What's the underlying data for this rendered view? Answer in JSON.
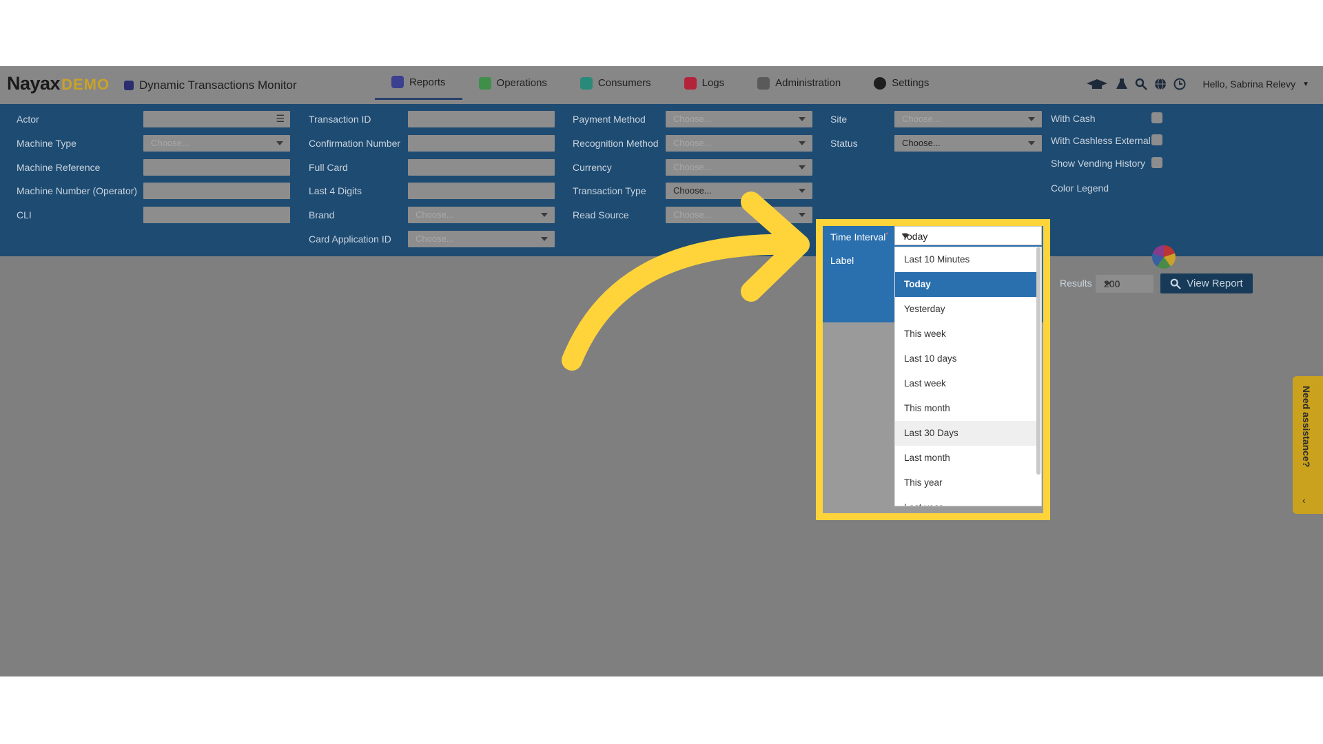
{
  "header": {
    "logo_main": "Nayax",
    "logo_badge": "DEMO",
    "page_title": "Dynamic Transactions Monitor",
    "nav": [
      {
        "label": "Reports",
        "icon": "chart-icon",
        "color": "#3a3f8f"
      },
      {
        "label": "Operations",
        "icon": "operations-icon",
        "color": "#3f8f4a"
      },
      {
        "label": "Consumers",
        "icon": "consumers-icon",
        "color": "#2a8a7a"
      },
      {
        "label": "Logs",
        "icon": "logs-icon",
        "color": "#b3243a"
      },
      {
        "label": "Administration",
        "icon": "administration-icon",
        "color": "#5a5a5a"
      },
      {
        "label": "Settings",
        "icon": "gear-icon",
        "color": "#1e1e1e"
      }
    ],
    "greeting": "Hello, Sabrina Relevy"
  },
  "filters": {
    "col1": [
      "Actor",
      "Machine Type",
      "Machine Reference",
      "Machine Number (Operator)",
      "CLI"
    ],
    "col2": [
      "Transaction ID",
      "Confirmation Number",
      "Full Card",
      "Last 4 Digits",
      "Brand",
      "Card Application ID"
    ],
    "col3": [
      "Payment Method",
      "Recognition Method",
      "Currency",
      "Transaction Type",
      "Read Source"
    ],
    "col4": [
      "Site",
      "Status"
    ],
    "col5": [
      "With Cash",
      "With Cashless External",
      "Show Vending History",
      "Color Legend"
    ],
    "choose_placeholder": "Choose...",
    "status_value": "Choose...",
    "transaction_type_value": "Choose..."
  },
  "time_interval": {
    "label": "Time Interval",
    "required_mark": "*",
    "label2": "Label",
    "selected": "Today",
    "options": [
      "Last 10 Minutes",
      "Today",
      "Yesterday",
      "This week",
      "Last 10 days",
      "Last week",
      "This month",
      "Last 30 Days",
      "Last month",
      "This year",
      "Last year"
    ]
  },
  "results": {
    "label": "Results",
    "value": "200",
    "view_report": "View Report"
  },
  "assist": {
    "label": "Need assistance?",
    "chevron": "‹"
  },
  "colors": {
    "highlight": "#ffd43b",
    "filter_band": "#1e4b72",
    "selected_option": "#2a6fae"
  }
}
